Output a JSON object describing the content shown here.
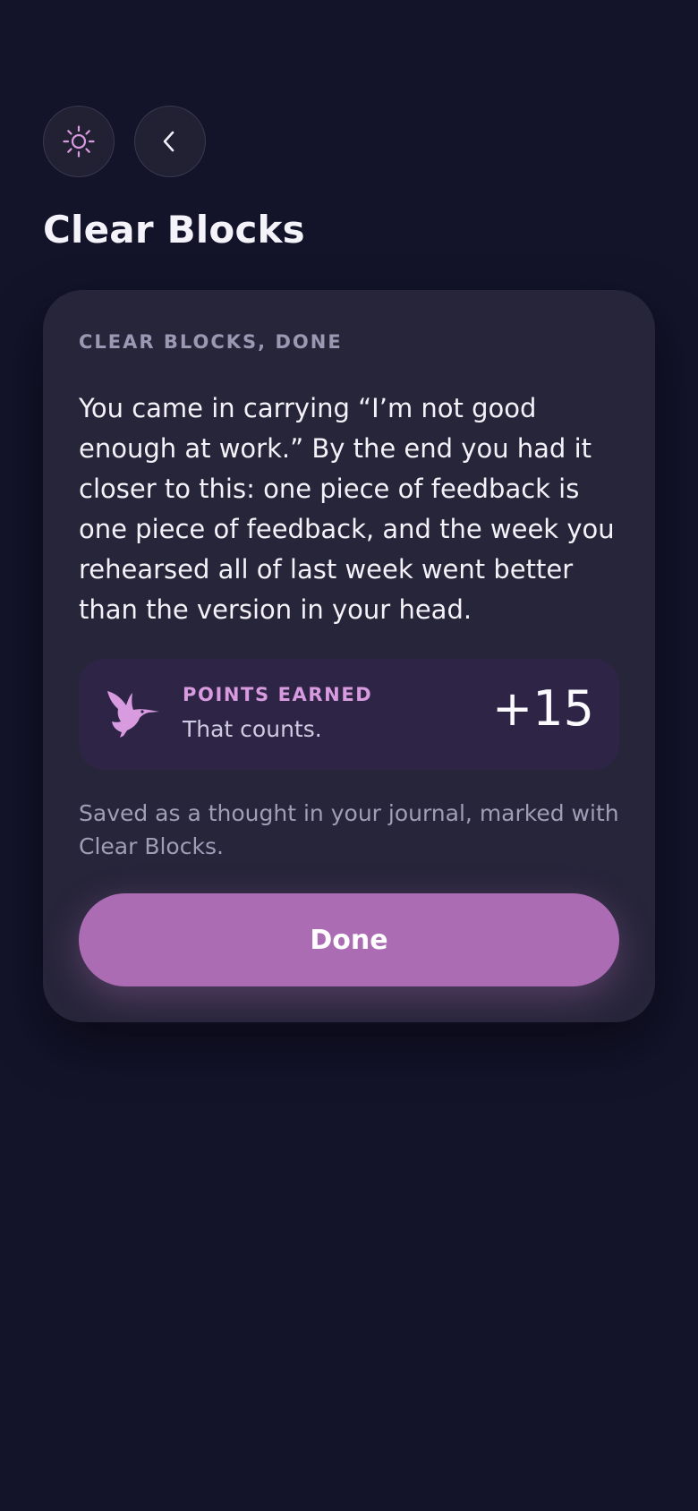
{
  "header": {
    "title": "Clear Blocks",
    "theme_icon": "sun-icon",
    "back_icon": "chevron-left-icon"
  },
  "card": {
    "eyebrow": "CLEAR BLOCKS, DONE",
    "body": "You came in carrying “I’m not good enough at work.” By the end you had it closer to this: one piece of feedback is one piece of feedback, and the week you rehearsed all of last week went better than the version in your head.",
    "points": {
      "icon": "hummingbird-icon",
      "label": "POINTS EARNED",
      "subtitle": "That counts.",
      "value": "+15"
    },
    "saved_note": "Saved as a thought in your journal, marked with Clear Blocks.",
    "done_label": "Done"
  },
  "colors": {
    "background": "#13132a",
    "card": "#27253a",
    "accent": "#ac6cb4",
    "accent_text": "#d99bdf"
  }
}
